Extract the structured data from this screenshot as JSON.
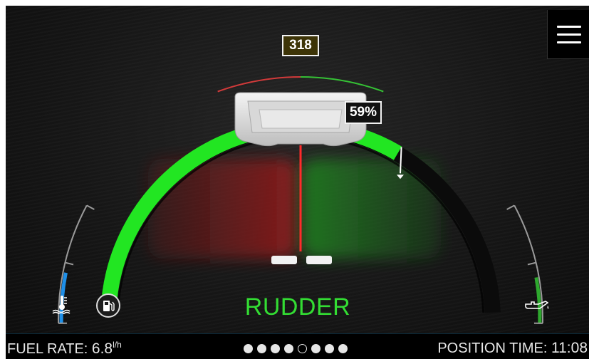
{
  "header": {
    "heading_value": "318",
    "position_percent_label": "59%"
  },
  "gauge": {
    "rudder_level": 0.59,
    "temperature_level": 0.42,
    "oil_pressure_level": 0.38,
    "colors": {
      "rudder_fill": "#22e622",
      "port_zone": "#7a1a1a",
      "starboard_zone": "#1f6b1f",
      "temperature": "#1e8fe8",
      "oil": "#2ea82e",
      "scale_red": "#d23a3a",
      "scale_green": "#35c235"
    }
  },
  "main": {
    "label": "RUDDER"
  },
  "status_bar": {
    "fuel_rate_label": "FUEL RATE:",
    "fuel_rate_value": "6.8",
    "fuel_rate_unit": "l/h",
    "position_time_label": "POSITION TIME:",
    "position_time_value": "11:08",
    "page_count": 8,
    "active_page": 5
  },
  "icons": {
    "menu": "menu-icon",
    "fuel": "fuel-pump-icon",
    "temperature": "water-temperature-icon",
    "oil": "oil-can-icon"
  }
}
